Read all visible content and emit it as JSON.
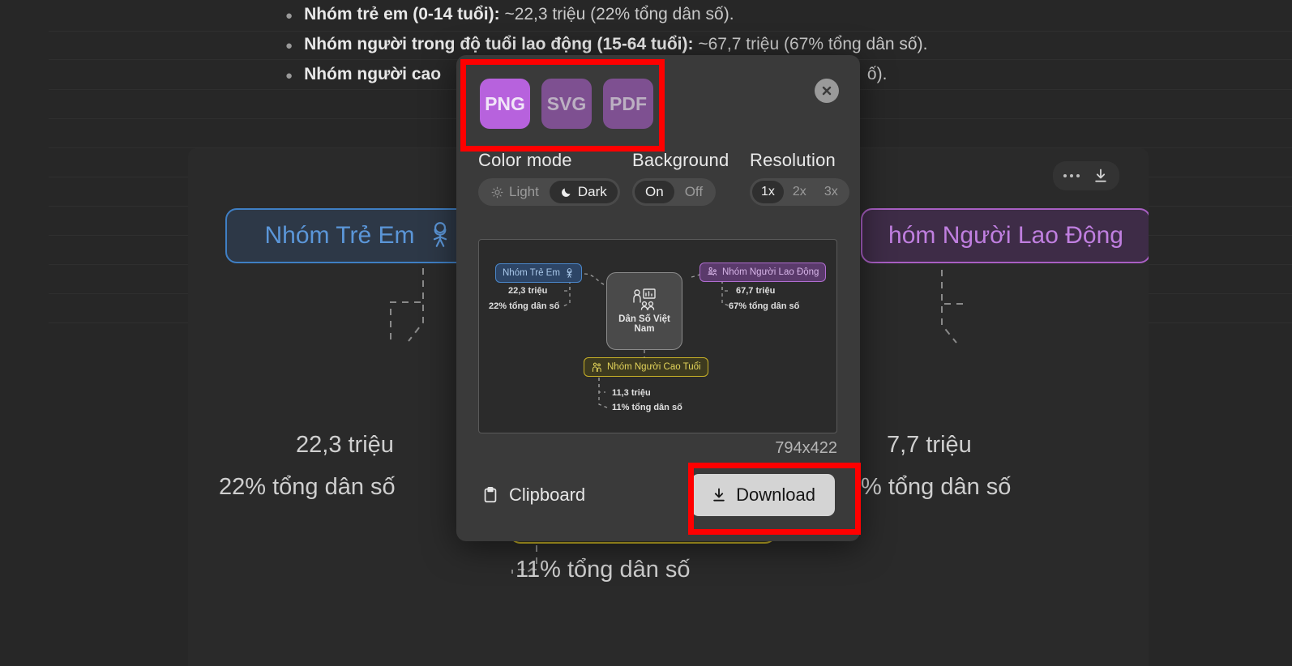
{
  "document": {
    "bullets": [
      {
        "strong": "Nhóm trẻ em (0-14 tuổi):",
        "rest": "~22,3 triệu (22% tổng dân số)."
      },
      {
        "strong": "Nhóm người trong độ tuổi lao động (15-64 tuổi):",
        "rest": "~67,7 triệu (67% tổng dân số)."
      },
      {
        "strong": "Nhóm người cao",
        "rest": "ố)."
      }
    ]
  },
  "canvas": {
    "toolbar": {
      "more_icon": "more-horizontal-icon",
      "download_icon": "download-icon"
    },
    "nodes": [
      {
        "label": "Nhóm Trẻ Em",
        "icon": "child-icon",
        "color": "#5b96d8"
      },
      {
        "label": "hóm Người Lao Động",
        "icon": "worker-icon",
        "color": "#c07fe0"
      },
      {
        "label": "người Cao Tuổi",
        "icon": "elderly-icon",
        "color": "#d9c63c"
      }
    ],
    "metrics": {
      "children_count": "22,3 triệu",
      "children_percent": "22% tổng dân số",
      "workers_count": "7,7 triệu",
      "workers_percent": "% tổng dân số",
      "elderly_percent": "11% tổng dân số"
    }
  },
  "dialog": {
    "formats": [
      {
        "label": "PNG",
        "selected": true
      },
      {
        "label": "SVG",
        "selected": false
      },
      {
        "label": "PDF",
        "selected": false
      }
    ],
    "close_icon": "close-icon",
    "color_mode": {
      "title": "Color mode",
      "options": [
        {
          "label": "Light",
          "icon": "sun-icon",
          "selected": false
        },
        {
          "label": "Dark",
          "icon": "moon-icon",
          "selected": true
        }
      ]
    },
    "background": {
      "title": "Background",
      "options": [
        {
          "label": "On",
          "selected": true
        },
        {
          "label": "Off",
          "selected": false
        }
      ]
    },
    "resolution": {
      "title": "Resolution",
      "options": [
        {
          "label": "1x",
          "selected": true
        },
        {
          "label": "2x",
          "selected": false
        },
        {
          "label": "3x",
          "selected": false
        }
      ]
    },
    "size_label": "794x422",
    "clipboard": {
      "label": "Clipboard",
      "icon": "clipboard-icon"
    },
    "download": {
      "label": "Download",
      "icon": "download-icon"
    },
    "preview": {
      "center": {
        "label_line1": "Dân Số Việt",
        "label_line2": "Nam",
        "icon": "presentation-people-icon"
      },
      "children": {
        "label": "Nhóm Trẻ Em",
        "icon": "child-icon",
        "count": "22,3 triệu",
        "percent": "22% tổng dân số"
      },
      "workers": {
        "label": "Nhóm Người Lao Động",
        "icon": "worker-icon",
        "count": "67,7 triệu",
        "percent": "67% tổng dân số"
      },
      "elderly": {
        "label": "Nhóm Người Cao Tuổi",
        "icon": "elderly-icon",
        "count": "11,3 triệu",
        "percent": "11% tổng dân số"
      }
    }
  },
  "annotations": {
    "format_box_color": "#ff0000",
    "download_box_color": "#ff0000"
  }
}
